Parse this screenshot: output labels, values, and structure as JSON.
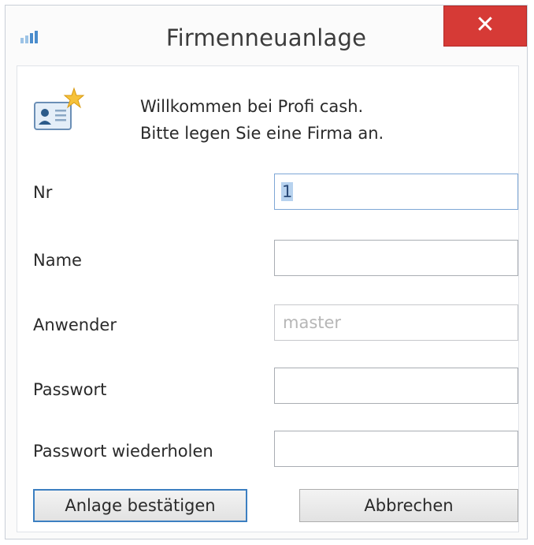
{
  "window": {
    "title": "Firmenneuanlage",
    "close_label": "✕"
  },
  "welcome": {
    "line1": "Willkommen bei Profi cash.",
    "line2": "Bitte legen Sie eine Firma an."
  },
  "form": {
    "nr": {
      "label": "Nr",
      "value": "1"
    },
    "name": {
      "label": "Name",
      "value": ""
    },
    "anwender": {
      "label": "Anwender",
      "placeholder": "master"
    },
    "passwort": {
      "label": "Passwort",
      "value": ""
    },
    "passwort_wiederholen": {
      "label": "Passwort wiederholen",
      "value": ""
    }
  },
  "buttons": {
    "confirm_label": "Anlage bestätigen",
    "cancel_label": "Abbrechen"
  },
  "icons": {
    "app": "bar-chart-icon",
    "welcome": "new-company-card-icon"
  },
  "colors": {
    "close_red": "#d63a36",
    "accent_blue": "#3c7fc1",
    "selection": "#b7d2ee"
  }
}
